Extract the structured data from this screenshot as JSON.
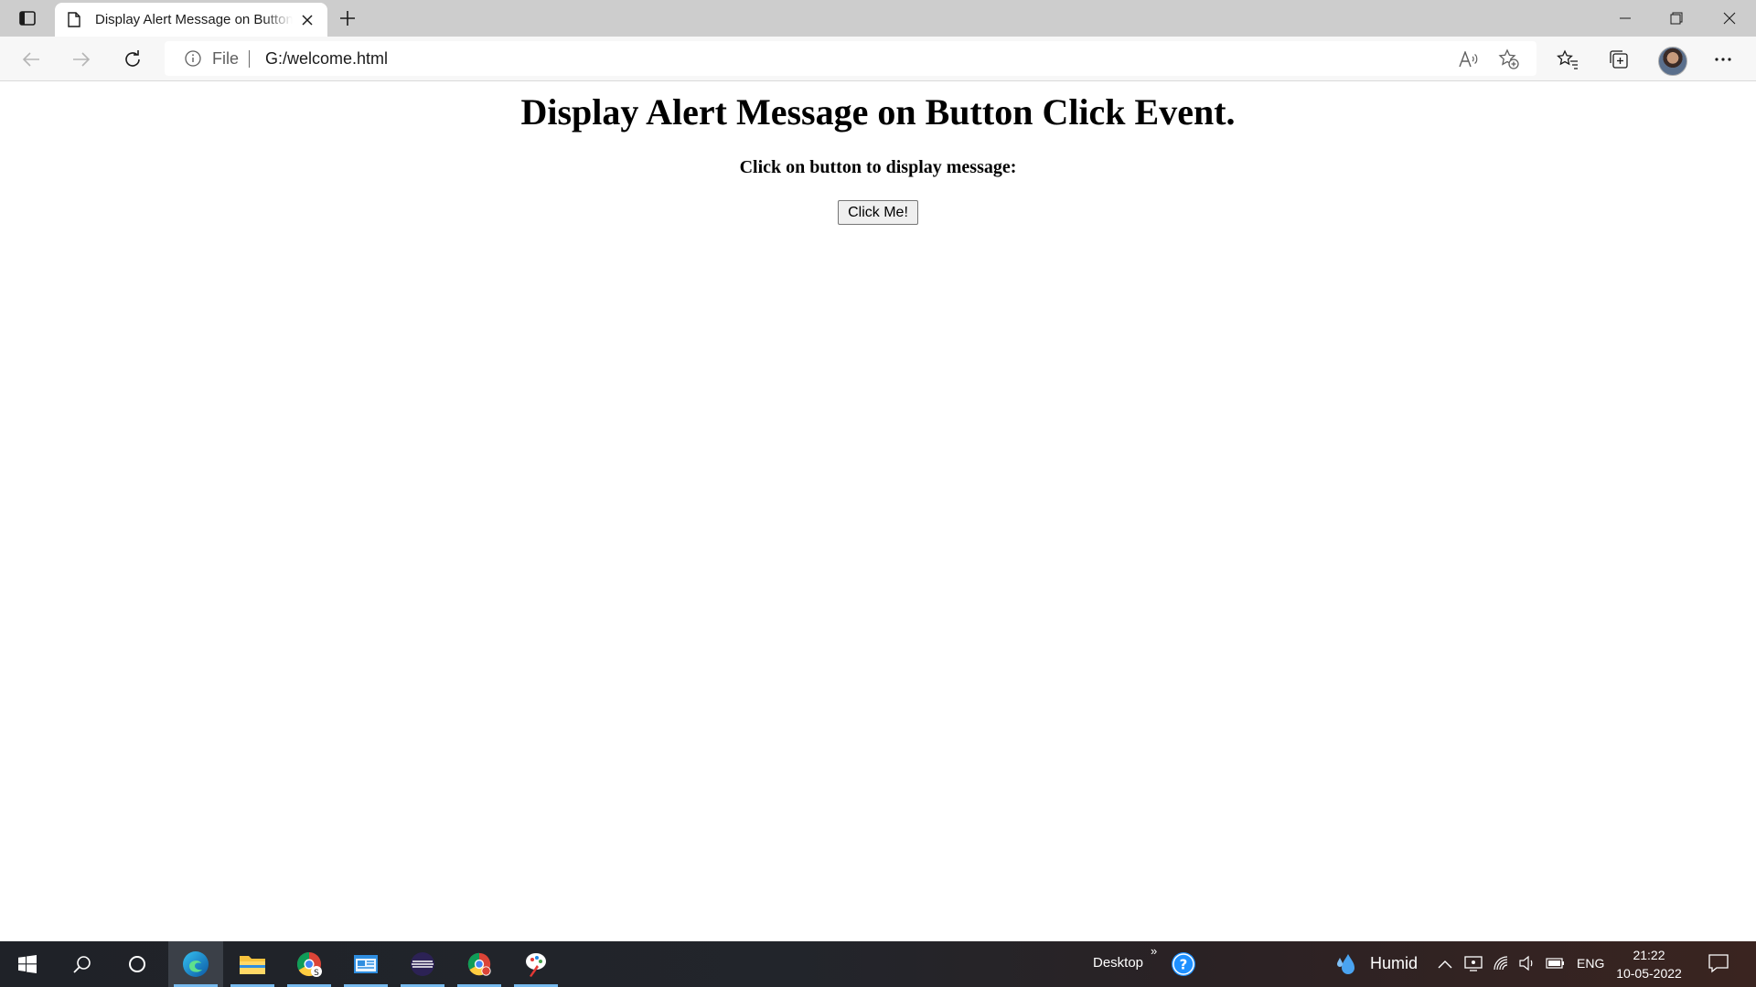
{
  "browser": {
    "tab_title": "Display Alert Message on Button Click Event.",
    "new_tab_symbol": "+",
    "address": {
      "scheme_label": "File",
      "url": "G:/welcome.html"
    }
  },
  "page": {
    "heading": "Display Alert Message on Button Click Event.",
    "instruction": "Click on button to display message:",
    "button_label": "Click Me!"
  },
  "taskbar": {
    "apps": [
      "windows-start",
      "search",
      "cortana",
      "edge",
      "file-explorer",
      "chrome-profile-1",
      "app-window",
      "eclipse",
      "chrome",
      "paint-app"
    ],
    "desktop_label": "Desktop",
    "desktop_chevron": "»",
    "weather_label": "Humid",
    "language": "ENG",
    "time": "21:22",
    "date": "10-05-2022"
  },
  "colors": {
    "tabstrip": "#cdcdcd",
    "toolbar": "#f7f7f7",
    "taskbar": "#1f2228",
    "taskbar_accent": "#76b9ed"
  }
}
